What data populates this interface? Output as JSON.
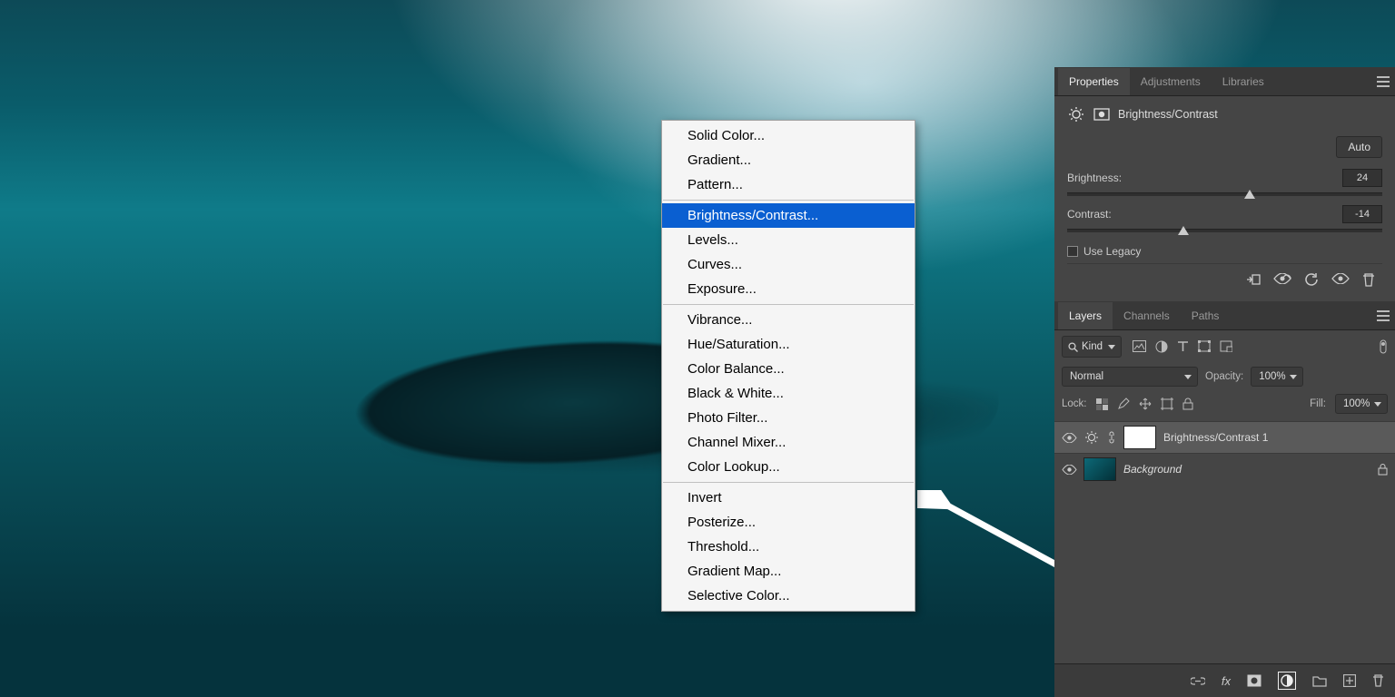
{
  "panels": {
    "properties": {
      "tabs": [
        "Properties",
        "Adjustments",
        "Libraries"
      ],
      "active_tab": 0,
      "title": "Brightness/Contrast",
      "auto_label": "Auto",
      "brightness_label": "Brightness:",
      "brightness_value": "24",
      "brightness_pos_pct": 58,
      "contrast_label": "Contrast:",
      "contrast_value": "-14",
      "contrast_pos_pct": 37,
      "legacy_label": "Use Legacy",
      "footer_icons": [
        "clip-to-layer-icon",
        "visibility-icon",
        "reset-icon",
        "toggle-visibility-icon",
        "delete-icon"
      ]
    },
    "layers": {
      "tabs": [
        "Layers",
        "Channels",
        "Paths"
      ],
      "active_tab": 0,
      "kind_label": "Kind",
      "filter_icons": [
        "image-filter-icon",
        "adjustment-filter-icon",
        "type-filter-icon",
        "shape-filter-icon",
        "smartobject-filter-icon"
      ],
      "blend_mode": "Normal",
      "opacity_label": "Opacity:",
      "opacity_value": "100%",
      "lock_label": "Lock:",
      "lock_icons": [
        "lock-pixels-icon",
        "lock-brush-icon",
        "lock-position-icon",
        "lock-artboard-icon",
        "lock-all-icon"
      ],
      "fill_label": "Fill:",
      "fill_value": "100%",
      "items": [
        {
          "name": "Brightness/Contrast 1",
          "type": "adjustment",
          "visible": true,
          "selected": true
        },
        {
          "name": "Background",
          "type": "image",
          "visible": true,
          "locked": true,
          "italic": true
        }
      ],
      "bottom_icons": [
        "link-layers-icon",
        "fx-icon",
        "mask-icon",
        "adjustment-layer-icon",
        "group-icon",
        "new-layer-icon",
        "delete-layer-icon"
      ]
    }
  },
  "context_menu": {
    "groups": [
      [
        "Solid Color...",
        "Gradient...",
        "Pattern..."
      ],
      [
        "Brightness/Contrast...",
        "Levels...",
        "Curves...",
        "Exposure..."
      ],
      [
        "Vibrance...",
        "Hue/Saturation...",
        "Color Balance...",
        "Black & White...",
        "Photo Filter...",
        "Channel Mixer...",
        "Color Lookup..."
      ],
      [
        "Invert",
        "Posterize...",
        "Threshold...",
        "Gradient Map...",
        "Selective Color..."
      ]
    ],
    "highlighted": "Brightness/Contrast..."
  }
}
